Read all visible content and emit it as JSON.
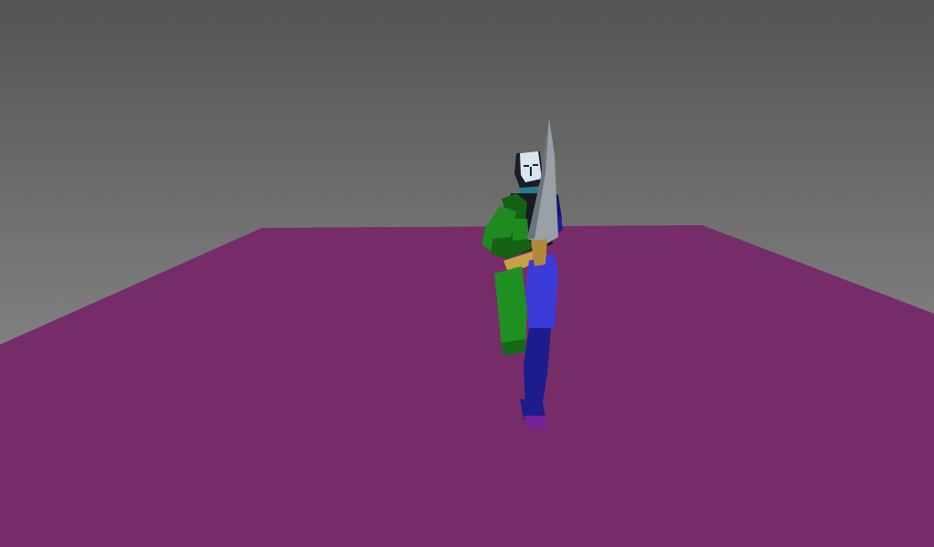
{
  "scene": {
    "sky_top_color": "#545454",
    "sky_bottom_color": "#9a9a9a",
    "floor_color": "#762c69",
    "floor_far_color": "#7a2e6c"
  },
  "character": {
    "pose": "kneeling-guard",
    "weapon": "sword",
    "colors": {
      "head": "#d9e6ef",
      "face_dark": "#1c1c24",
      "neck": "#1f7f8a",
      "right_arm": "#1f8a1f",
      "right_arm_dark": "#146314",
      "left_arm": "#1d1d9a",
      "left_arm_dark": "#12126a",
      "belt": "#c6a14a",
      "right_leg": "#1f8f22",
      "right_leg_dark": "#126a14",
      "left_leg": "#3b3bd9",
      "left_leg_dark": "#1c1c8c",
      "foot": "#7a1f9a",
      "blade": "#9aa0a8",
      "blade_dark": "#6c737c"
    }
  }
}
